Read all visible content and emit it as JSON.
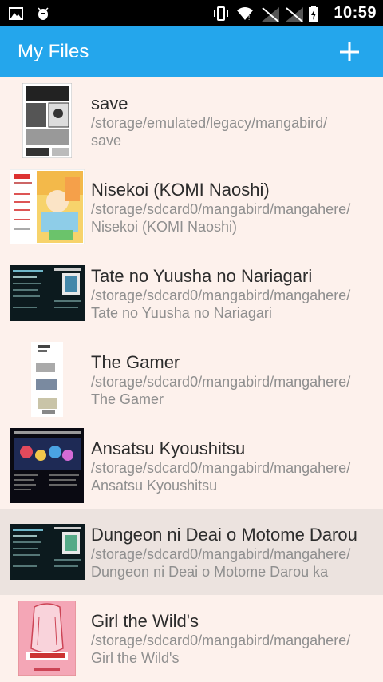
{
  "status_bar": {
    "time": "10:59",
    "icons": [
      "image-icon",
      "android-debug-icon",
      "vibrate-icon",
      "wifi-icon",
      "no-signal-icon",
      "no-signal-icon",
      "battery-charging-icon"
    ]
  },
  "app_bar": {
    "title": "My Files",
    "add_icon": "plus-icon"
  },
  "colors": {
    "app_bar": "#24a6ec",
    "background": "#fdf1ec",
    "selected_row": "#ece3df",
    "title_text": "#2c2c2c",
    "path_text": "#8f8f8f"
  },
  "items": [
    {
      "title": "save",
      "path_line1": "/storage/emulated/legacy/mangabird/",
      "path_line2": "save",
      "thumbnail": "manga-bw"
    },
    {
      "title": "Nisekoi (KOMI Naoshi)",
      "path_line1": "/storage/sdcard0/mangabird/mangahere/",
      "path_line2": "Nisekoi (KOMI Naoshi)",
      "thumbnail": "manga-color"
    },
    {
      "title": "Tate no Yuusha no Nariagari",
      "path_line1": "/storage/sdcard0/mangabird/mangahere/",
      "path_line2": "Tate no Yuusha no Nariagari",
      "thumbnail": "dark-page"
    },
    {
      "title": "The Gamer",
      "path_line1": "/storage/sdcard0/mangabird/mangahere/",
      "path_line2": "The Gamer",
      "thumbnail": "webtoon"
    },
    {
      "title": "Ansatsu Kyoushitsu",
      "path_line1": "/storage/sdcard0/mangabird/mangahere/",
      "path_line2": "Ansatsu Kyoushitsu",
      "thumbnail": "dark-scene"
    },
    {
      "title": "Dungeon ni Deai o Motome  Darou",
      "path_line1": "/storage/sdcard0/mangabird/mangahere/",
      "path_line2": "Dungeon ni Deai o Motome  Darou ka",
      "thumbnail": "dark-page"
    },
    {
      "title": "Girl the Wild's",
      "path_line1": "/storage/sdcard0/mangabird/mangahere/",
      "path_line2": "Girl the Wild's",
      "thumbnail": "pink-cover"
    }
  ],
  "selected_index": 5
}
